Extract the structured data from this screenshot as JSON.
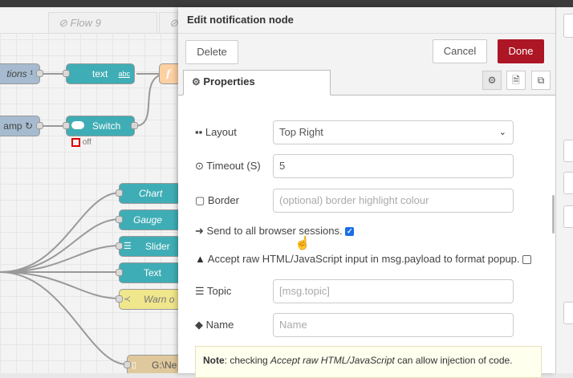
{
  "workspace": {
    "tabs": [
      {
        "label": "Flow 9"
      },
      {
        "label": ""
      }
    ]
  },
  "flow_nodes": [
    {
      "label": "tions ¹",
      "kind": "inject"
    },
    {
      "label": "text",
      "badge": "abc",
      "kind": "text"
    },
    {
      "label": "f",
      "kind": "function"
    },
    {
      "label": "amp ↻",
      "kind": "inject"
    },
    {
      "label": "Switch",
      "kind": "switch",
      "status": "off"
    },
    {
      "label": "Chart",
      "kind": "chart"
    },
    {
      "label": "Gauge",
      "kind": "gauge"
    },
    {
      "label": "Slider",
      "kind": "slider"
    },
    {
      "label": "Text",
      "kind": "text"
    },
    {
      "label": "Warn o",
      "kind": "notification"
    },
    {
      "label": "G:\\Ne",
      "kind": "file"
    }
  ],
  "editor": {
    "title": "Edit notification node",
    "delete_label": "Delete",
    "cancel_label": "Cancel",
    "done_label": "Done",
    "properties_tab": "Properties",
    "layout_label": "Layout",
    "layout_value": "Top Right",
    "timeout_label": "Timeout (S)",
    "timeout_value": "5",
    "border_label": "Border",
    "border_placeholder": "(optional) border highlight colour",
    "send_all_label": "Send to all browser sessions.",
    "send_all_checked": true,
    "raw_html_label": "Accept raw HTML/JavaScript input in msg.payload to format popup.",
    "raw_html_checked": false,
    "topic_label": "Topic",
    "topic_placeholder": "[msg.topic]",
    "name_label": "Name",
    "name_placeholder": "Name",
    "note_bold": "Note",
    "note_text_1": ": checking ",
    "note_italic": "Accept raw HTML/JavaScript",
    "note_text_2": " can allow injection of code."
  },
  "colors": {
    "done_button": "#ad1625",
    "dashboard_node": "#3fadb5",
    "function_node": "#fdd0a2",
    "inject_node": "#a6bbcf",
    "notification_node": "#f0e68c"
  }
}
